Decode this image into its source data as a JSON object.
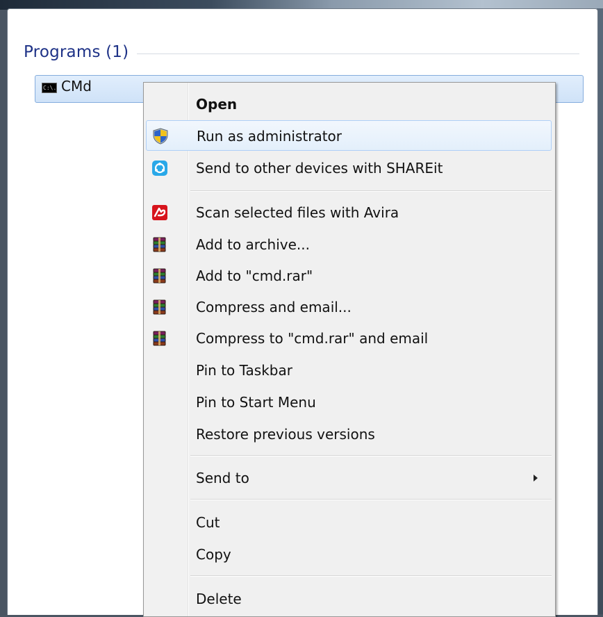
{
  "start_menu": {
    "section_title": "Programs (1)",
    "program": {
      "label": "CMd",
      "icon": "cmd-icon",
      "icon_text": "C:\\."
    }
  },
  "context_menu": {
    "items": [
      {
        "label": "Open",
        "bold": true,
        "icon": null
      },
      {
        "label": "Run as administrator",
        "icon": "uac-shield-icon",
        "highlighted": true
      },
      {
        "label": "Send to other devices with SHAREit",
        "icon": "shareit-icon"
      },
      {
        "label": "Scan selected files with Avira",
        "icon": "avira-icon"
      },
      {
        "label": "Add to archive...",
        "icon": "winrar-icon"
      },
      {
        "label": "Add to \"cmd.rar\"",
        "icon": "winrar-icon"
      },
      {
        "label": "Compress and email...",
        "icon": "winrar-icon"
      },
      {
        "label": "Compress to \"cmd.rar\" and email",
        "icon": "winrar-icon"
      },
      {
        "label": "Pin to Taskbar",
        "icon": null
      },
      {
        "label": "Pin to Start Menu",
        "icon": null
      },
      {
        "label": "Restore previous versions",
        "icon": null
      },
      {
        "label": "Send to",
        "icon": null,
        "submenu": true
      },
      {
        "label": "Cut",
        "icon": null
      },
      {
        "label": "Copy",
        "icon": null
      },
      {
        "label": "Delete",
        "icon": null
      }
    ]
  },
  "colors": {
    "section_title": "#1e3287",
    "selection_border": "#84acdd",
    "menu_background": "#f0f0f0",
    "highlight_border": "#aecff7"
  }
}
